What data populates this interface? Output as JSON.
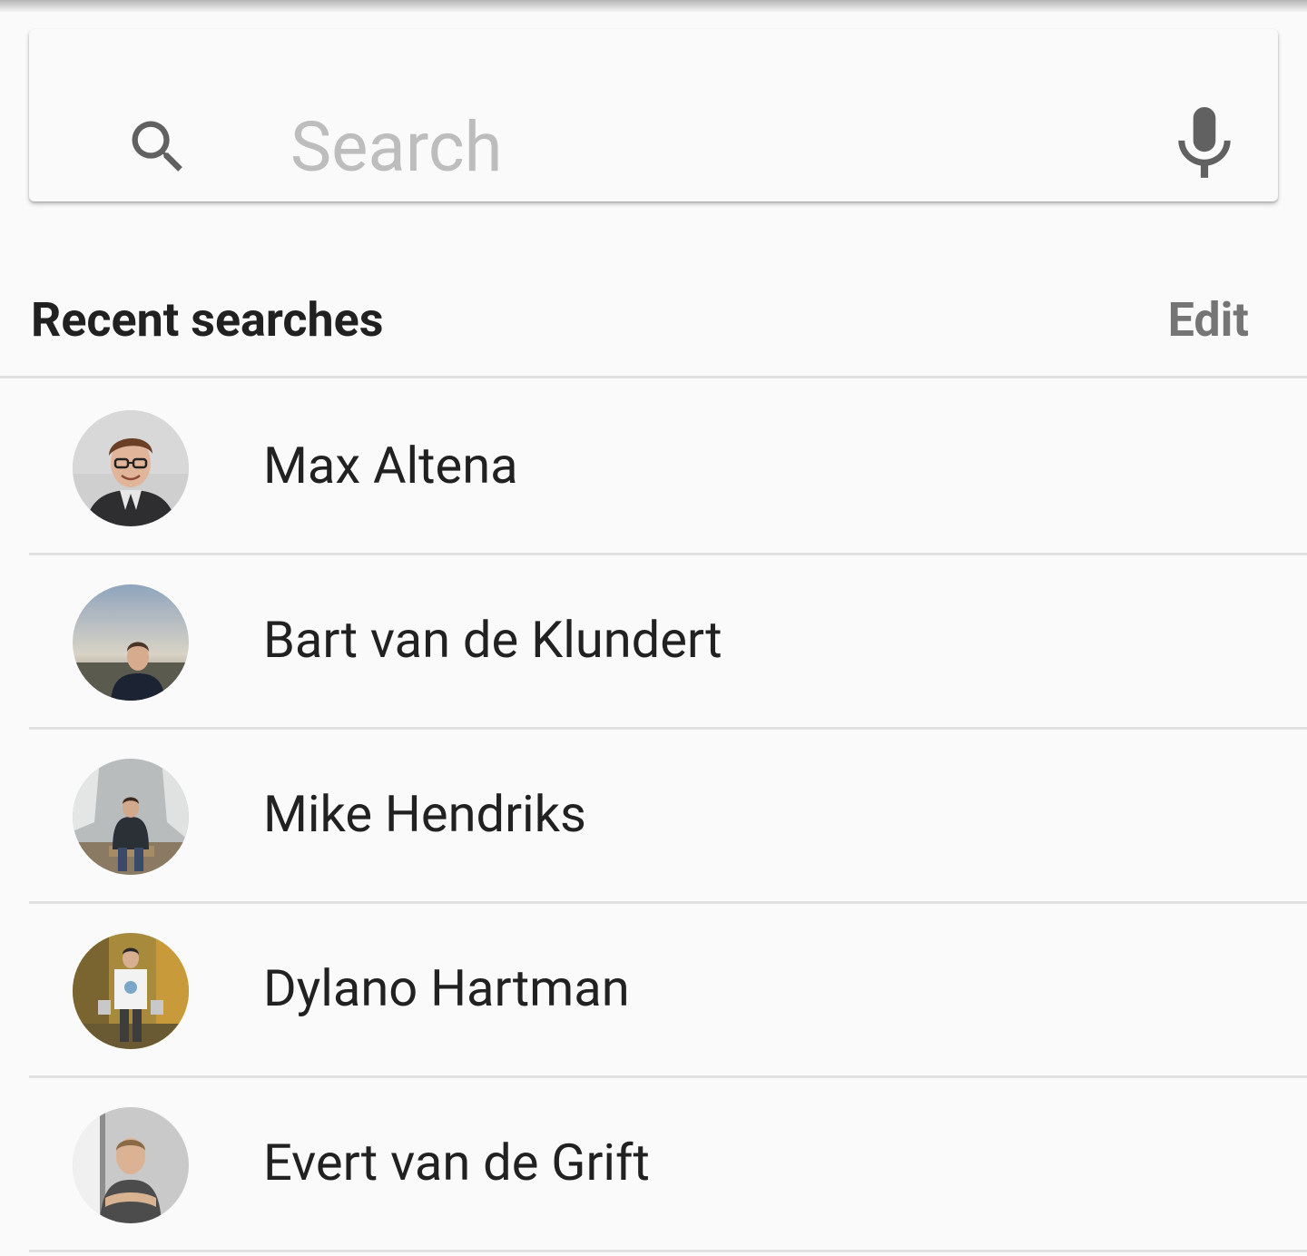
{
  "search": {
    "placeholder": "Search",
    "value": ""
  },
  "recent": {
    "title": "Recent searches",
    "edit_label": "Edit",
    "items": [
      {
        "name": "Max Altena"
      },
      {
        "name": "Bart van de Klundert"
      },
      {
        "name": "Mike Hendriks"
      },
      {
        "name": "Dylano Hartman"
      },
      {
        "name": "Evert van de Grift"
      }
    ]
  },
  "icons": {
    "search": "search-icon",
    "mic": "mic-icon",
    "avatar": "avatar"
  },
  "colors": {
    "background": "#fafafa",
    "primary_text": "#212121",
    "secondary_text": "#757575",
    "placeholder": "#bdbdbd",
    "icon": "#616161",
    "divider": "#e0e0e0"
  }
}
